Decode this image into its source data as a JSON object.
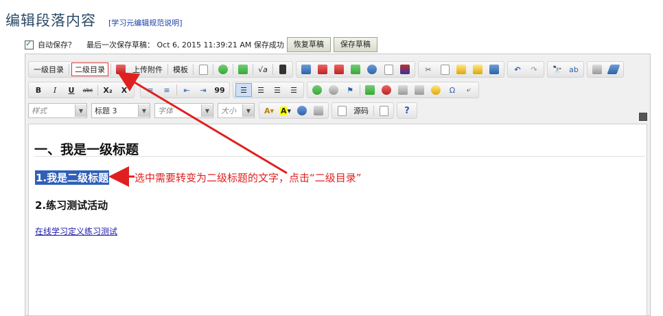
{
  "header": {
    "title": "编辑段落内容",
    "help_link": "学习元编辑规范说明"
  },
  "autosave": {
    "label": "自动保存？",
    "status": "最后一次保存草稿：  Oct 6, 2015 11:39:21 AM 保存成功",
    "restore_button": "恢复草稿",
    "save_button": "保存草稿"
  },
  "toolbar": {
    "level1_toc": "一级目录",
    "level2_toc": "二级目录",
    "upload": "上传附件",
    "template": "模板",
    "bold": "B",
    "italic": "I",
    "underline": "U",
    "strike": "abc",
    "subscript": "X₂",
    "superscript": "X",
    "style_placeholder": "样式",
    "format_value": "标题 3",
    "font_placeholder": "字体",
    "size_placeholder": "大小",
    "source": "源码",
    "help": "?",
    "quote": "99",
    "omega": "Ω"
  },
  "content": {
    "heading1": "一、我是一级标题",
    "heading2_selected": "1.我是二级标题",
    "heading2": "2.练习测试活动",
    "link": "在线学习定义练习测试"
  },
  "annotation": {
    "text": "选中需要转变为二级标题的文字，点击“二级目录”",
    "color": "#e02020"
  },
  "colors": {
    "title": "#2a4a66",
    "selection": "#2f5fb8",
    "link": "#1a1aa8"
  }
}
